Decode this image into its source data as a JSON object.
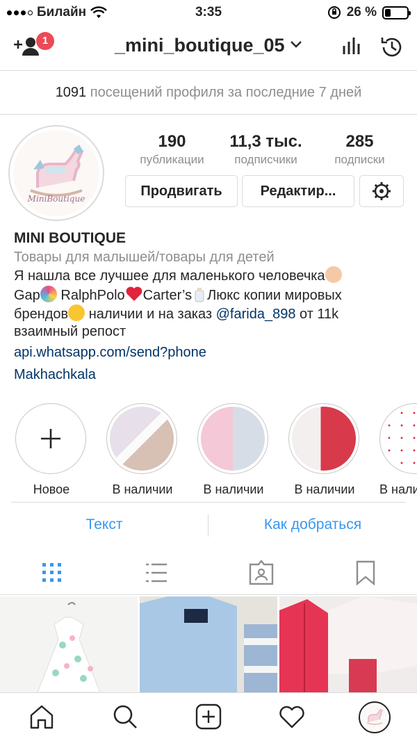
{
  "status_bar": {
    "carrier": "Билайн",
    "time": "3:35",
    "battery_percent": "26 %",
    "battery_level": 0.26
  },
  "header": {
    "username": "_mini_boutique_05",
    "notifications_count": "1"
  },
  "visits": {
    "count": "1091",
    "text": " посещений профиля за последние 7 дней"
  },
  "profile": {
    "stats": [
      {
        "value": "190",
        "label": "публикации"
      },
      {
        "value": "11,3 тыс.",
        "label": "подписчики"
      },
      {
        "value": "285",
        "label": "подписки"
      }
    ],
    "buttons": {
      "promote": "Продвигать",
      "edit": "Редактир..."
    },
    "avatar_text": "MiniBoutique"
  },
  "bio": {
    "name": "MINI BOUTIQUE",
    "category": "Товары для малышей/товары для детей",
    "line1": "Я нашла все лучшее для маленького человечка",
    "line2a": "Gap",
    "line2b": "RalphPolo",
    "line2c": "Carter’s",
    "line2d": "Люкс копии мировых",
    "line3a": "брендов",
    "line3b": "наличии и на заказ ",
    "mention": "@farida_898",
    "line3c": " от 11k",
    "line4": "взаимный репост",
    "link": "api.whatsapp.com/send?phone",
    "location": "Makhachkala"
  },
  "highlights": [
    {
      "label": "Новое"
    },
    {
      "label": "В наличии"
    },
    {
      "label": "В наличии"
    },
    {
      "label": "В наличии"
    },
    {
      "label": "В нали"
    }
  ],
  "actions": {
    "text": "Текст",
    "directions": "Как добраться"
  },
  "tabs": [
    {
      "icon": "grid-icon"
    },
    {
      "icon": "list-icon"
    },
    {
      "icon": "tagged-icon"
    },
    {
      "icon": "bookmark-icon"
    }
  ],
  "bottom_nav": [
    {
      "icon": "home-icon"
    },
    {
      "icon": "search-icon"
    },
    {
      "icon": "add-post-icon"
    },
    {
      "icon": "heart-icon"
    },
    {
      "icon": "profile-avatar"
    }
  ],
  "colors": {
    "link": "#3897f0",
    "badge": "#ed4956",
    "muted": "#8e8e8e",
    "border": "#dbdbdb",
    "mention": "#003569"
  }
}
